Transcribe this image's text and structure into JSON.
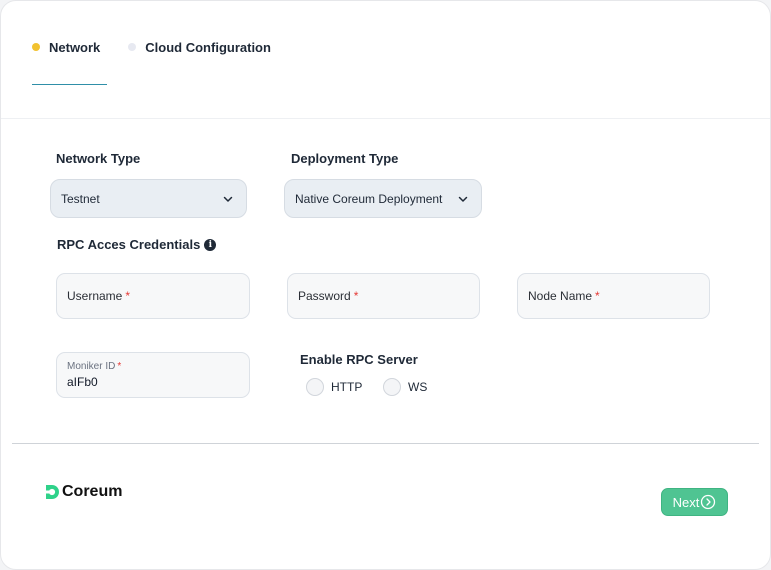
{
  "tabs": [
    {
      "label": "Network",
      "active": true
    },
    {
      "label": "Cloud Configuration",
      "active": false
    }
  ],
  "network_type": {
    "label": "Network Type",
    "value": "Testnet",
    "icon": "chevron-down-icon"
  },
  "deployment_type": {
    "label": "Deployment Type",
    "value": "Native Coreum Deployment",
    "icon": "chevron-down-icon"
  },
  "rpc_credentials": {
    "title": "RPC Acces Credentials",
    "info_icon": "i",
    "username": {
      "placeholder": "Username",
      "required_mark": "*"
    },
    "password": {
      "placeholder": "Password",
      "required_mark": "*"
    },
    "node_name": {
      "placeholder": "Node Name",
      "required_mark": "*"
    },
    "moniker": {
      "label": "Moniker ID",
      "required_mark": "*",
      "value": "aIFb0"
    }
  },
  "rpc_server": {
    "title": "Enable RPC Server",
    "options": [
      {
        "label": "HTTP",
        "selected": false
      },
      {
        "label": "WS",
        "selected": false
      }
    ]
  },
  "footer": {
    "brand": "Coreum",
    "next_label": "Next"
  },
  "colors": {
    "accent": "#4fc492",
    "active_dot": "#f2c230",
    "tab_underline": "#2f8fa8",
    "required": "#e53935"
  }
}
